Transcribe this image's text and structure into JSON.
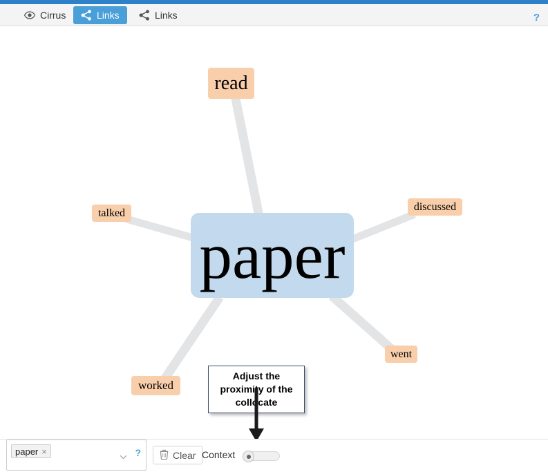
{
  "app": {
    "accent_color": "#2e80c8",
    "active_tab_color": "#4a9fd8",
    "annotation_color": "#b00000"
  },
  "toolbar": {
    "tabs": [
      {
        "label": "Cirrus",
        "icon": "eye-icon",
        "active": false
      },
      {
        "label": "Links",
        "icon": "share-icon",
        "active": true
      },
      {
        "label": "Links",
        "icon": "share-icon",
        "active": false
      }
    ],
    "help_label": "?"
  },
  "graph": {
    "center": {
      "label": "paper",
      "color": "#c3d9ed"
    },
    "nodes": [
      {
        "label": "read",
        "color": "#f8ceab"
      },
      {
        "label": "talked",
        "color": "#f8ceab"
      },
      {
        "label": "discussed",
        "color": "#f8ceab"
      },
      {
        "label": "went",
        "color": "#f8ceab"
      },
      {
        "label": "worked",
        "color": "#f8ceab"
      }
    ],
    "edge_color": "#e2e4e6"
  },
  "callout": {
    "text": "Adjust the proximity of the collocate"
  },
  "footer": {
    "token_label": "paper",
    "token_remove": "×",
    "dropdown_icon": "chevron-down-icon",
    "help_label": "?",
    "clear_label": "Clear",
    "clear_icon": "trash-icon",
    "context_label": "Context",
    "slider_value": "0"
  }
}
